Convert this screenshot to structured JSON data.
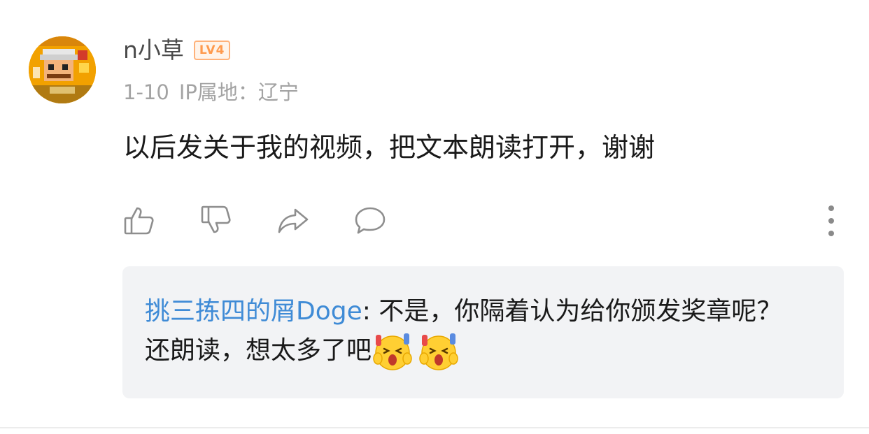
{
  "comment": {
    "avatar_icon": "pixel-game-character-avatar",
    "username": "n小草",
    "level_badge": "LV4",
    "date": "1-10",
    "ip_location": "IP属地：辽宁",
    "text": "以后发关于我的视频，把文本朗读打开，谢谢"
  },
  "actions": {
    "like_icon": "thumbs-up-icon",
    "dislike_icon": "thumbs-down-icon",
    "share_icon": "share-icon",
    "reply_icon": "comment-bubble-icon",
    "more_icon": "vertical-ellipsis-icon"
  },
  "reply": {
    "author": "挑三拣四的屑Doge",
    "separator": ": ",
    "text": "不是，你隔着认为给你颁发奖章呢？还朗读，想太多了吧",
    "emojis": [
      "screaming-face-emoji",
      "screaming-face-emoji"
    ]
  },
  "colors": {
    "username": "#4a4a4a",
    "meta": "#a3a3a3",
    "reply_author": "#3f8bd6",
    "reply_background": "#f2f3f5",
    "level_badge": "#ff9a4d"
  }
}
